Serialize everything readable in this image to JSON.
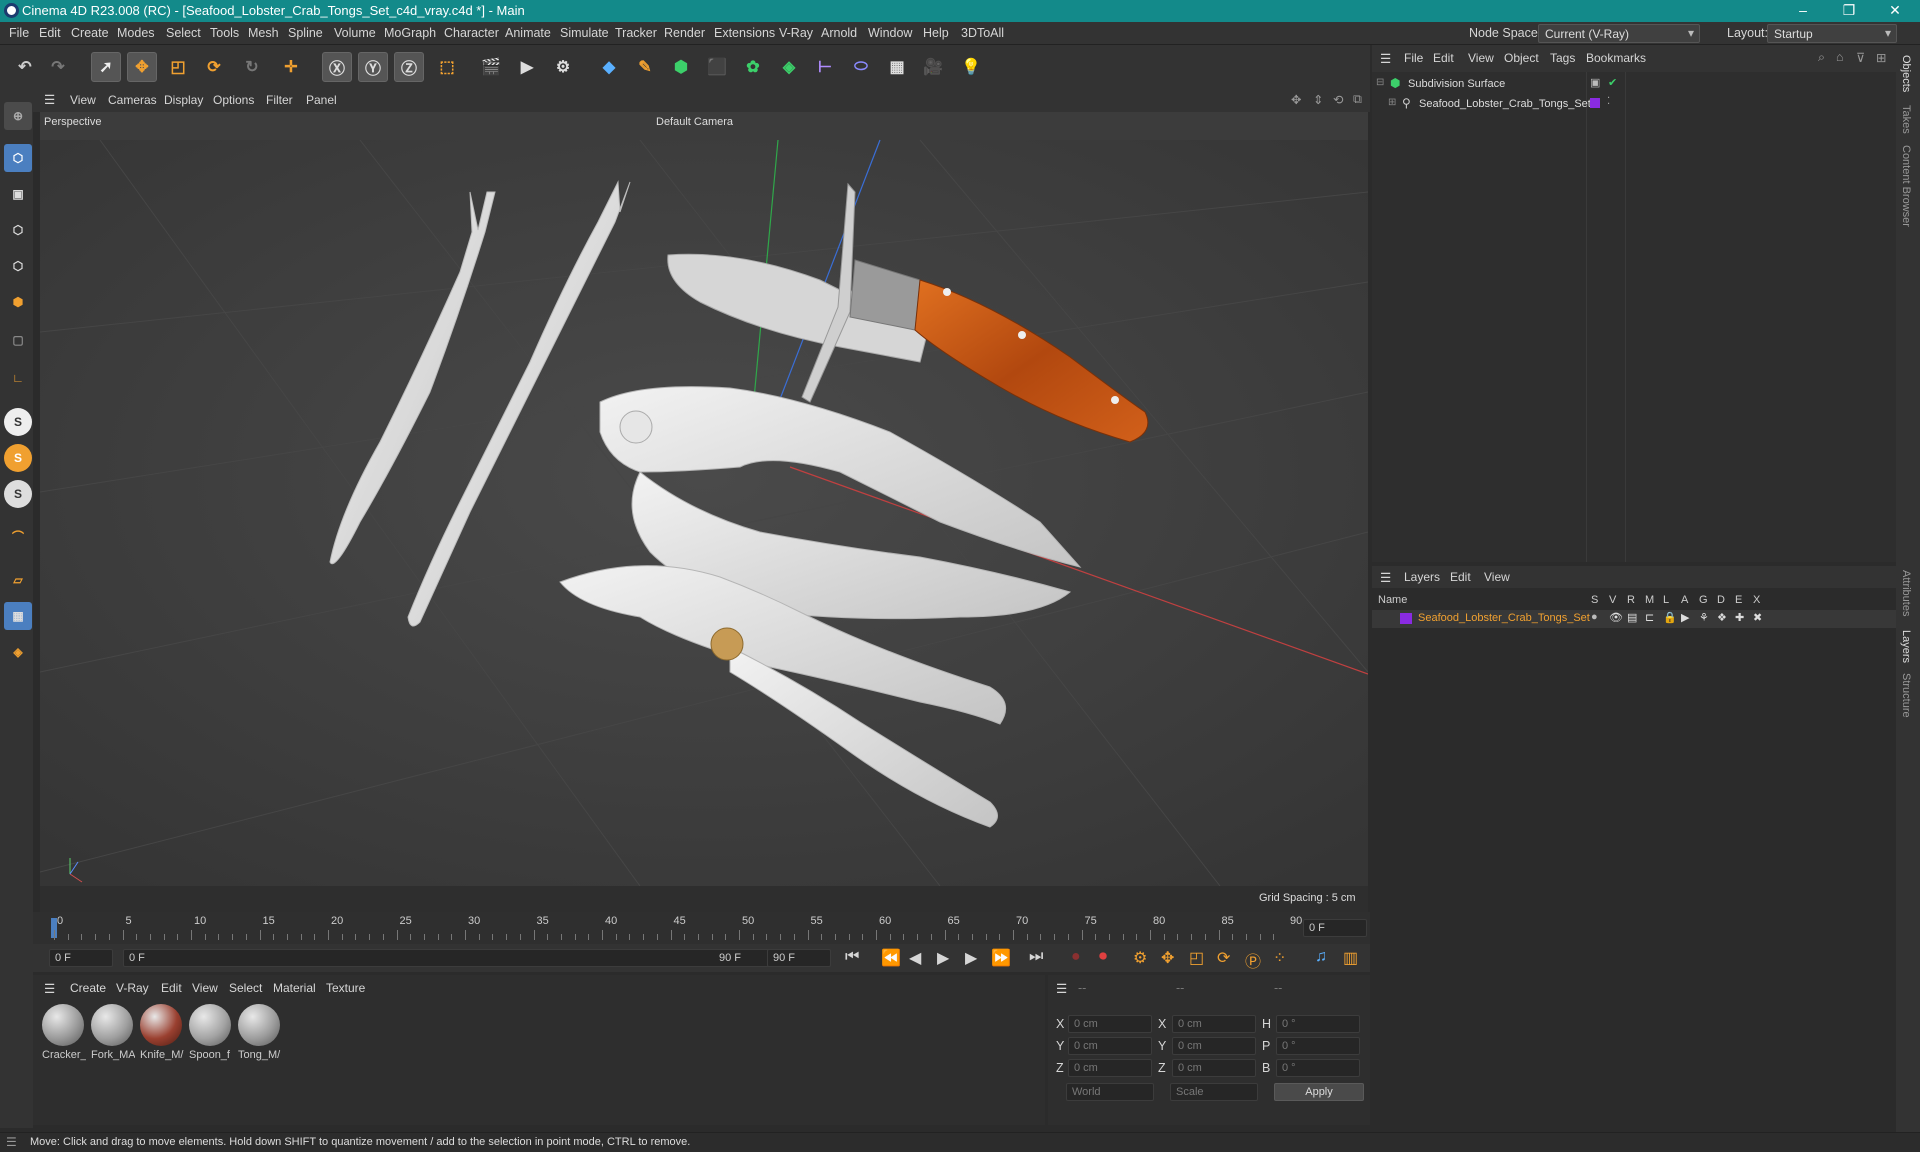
{
  "window": {
    "title": "Cinema 4D R23.008 (RC) - [Seafood_Lobster_Crab_Tongs_Set_c4d_vray.c4d *] - Main",
    "buttons": [
      "–",
      "❐",
      "✕"
    ]
  },
  "menubar": {
    "items": [
      "File",
      "Edit",
      "Create",
      "Modes",
      "Select",
      "Tools",
      "Mesh",
      "Spline",
      "Volume",
      "MoGraph",
      "Character",
      "Animate",
      "Simulate",
      "Tracker",
      "Render",
      "Extensions",
      "V-Ray",
      "Arnold",
      "Window",
      "Help",
      "3DToAll"
    ],
    "node_space_label": "Node Space:",
    "node_space_value": "Current (V-Ray)",
    "layout_label": "Layout:",
    "layout_value": "Startup"
  },
  "viewport": {
    "menu": [
      "View",
      "Cameras",
      "Display",
      "Options",
      "Filter",
      "Panel"
    ],
    "name": "Perspective",
    "camera": "Default Camera",
    "grid_spacing": "Grid Spacing : 5 cm"
  },
  "timeline": {
    "ticks": [
      "0",
      "5",
      "10",
      "15",
      "20",
      "25",
      "30",
      "35",
      "40",
      "45",
      "50",
      "55",
      "60",
      "65",
      "70",
      "75",
      "80",
      "85",
      "90"
    ],
    "current_frame": "0 F"
  },
  "transport": {
    "start_frame": "0 F",
    "range_start": "0 F",
    "range_end": "90 F",
    "end_frame": "90 F"
  },
  "materials": {
    "menu": [
      "Create",
      "V-Ray",
      "Edit",
      "View",
      "Select",
      "Material",
      "Texture"
    ],
    "items": [
      {
        "label": "Cracker_",
        "color": "#9a9a9a"
      },
      {
        "label": "Fork_MA",
        "color": "#a0a0a0"
      },
      {
        "label": "Knife_M/",
        "color": "#9a4030"
      },
      {
        "label": "Spoon_f",
        "color": "#a3a3a3"
      },
      {
        "label": "Tong_M/",
        "color": "#9d9d9d"
      }
    ]
  },
  "coords": {
    "headers": [
      "--",
      "--",
      "--"
    ],
    "rows": [
      {
        "a": "X",
        "v1": "0 cm",
        "b": "X",
        "v2": "0 cm",
        "c": "H",
        "v3": "0 °"
      },
      {
        "a": "Y",
        "v1": "0 cm",
        "b": "Y",
        "v2": "0 cm",
        "c": "P",
        "v3": "0 °"
      },
      {
        "a": "Z",
        "v1": "0 cm",
        "b": "Z",
        "v2": "0 cm",
        "c": "B",
        "v3": "0 °"
      }
    ],
    "world": "World",
    "scale": "Scale",
    "apply": "Apply"
  },
  "objects": {
    "menu": [
      "File",
      "Edit",
      "View",
      "Object",
      "Tags",
      "Bookmarks"
    ],
    "items": [
      {
        "name": "Subdivision Surface"
      },
      {
        "name": "Seafood_Lobster_Crab_Tongs_Set"
      }
    ]
  },
  "layers": {
    "menu": [
      "Layers",
      "Edit",
      "View"
    ],
    "columns": [
      "Name",
      "S",
      "V",
      "R",
      "M",
      "L",
      "A",
      "G",
      "D",
      "E",
      "X"
    ],
    "items": [
      {
        "name": "Seafood_Lobster_Crab_Tongs_Set",
        "color": "#8a2be2"
      }
    ]
  },
  "right_tabs": [
    "Objects",
    "Takes",
    "Content Browser",
    "Attributes",
    "Layers",
    "Structure"
  ],
  "status": "Move: Click and drag to move elements. Hold down SHIFT to quantize movement / add to the selection in point mode, CTRL to remove.",
  "colors": {
    "titlebar": "#138a8a",
    "accent": "#4b7fc0",
    "layer": "#8a2be2",
    "knife_handle": "#c45a1a"
  }
}
